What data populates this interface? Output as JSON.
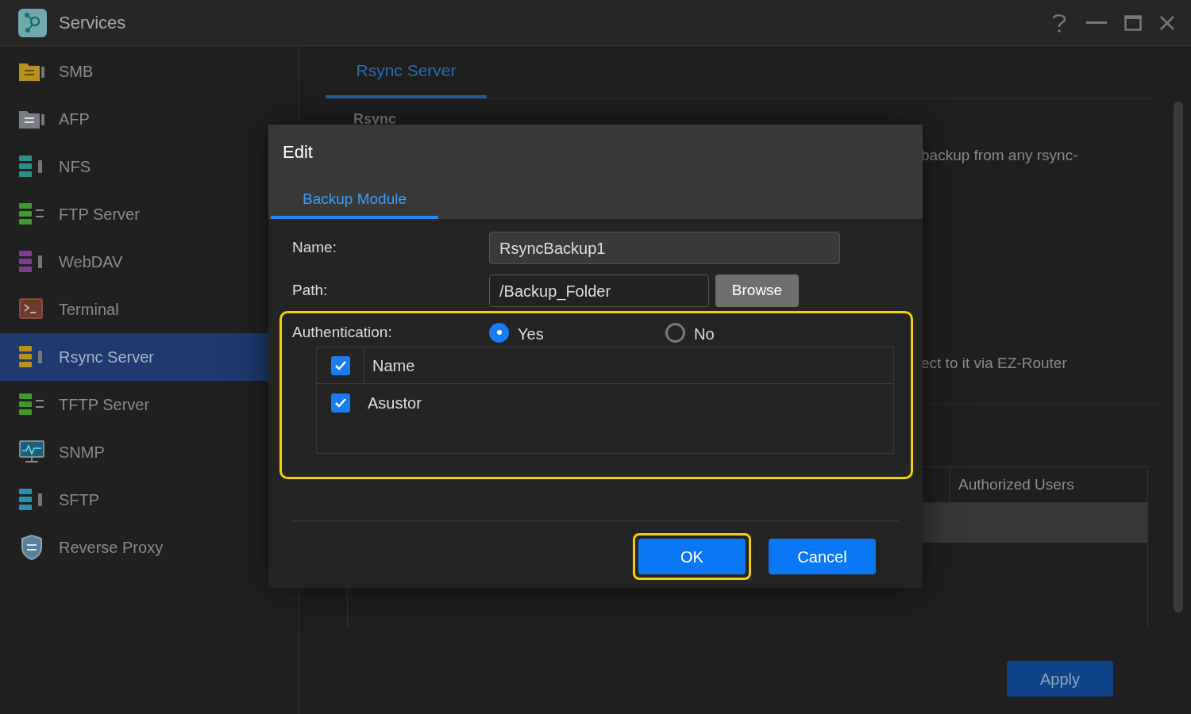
{
  "window": {
    "title": "Services"
  },
  "sidebar": {
    "items": [
      {
        "label": "SMB",
        "selected": false
      },
      {
        "label": "AFP",
        "selected": false
      },
      {
        "label": "NFS",
        "selected": false
      },
      {
        "label": "FTP Server",
        "selected": false
      },
      {
        "label": "WebDAV",
        "selected": false
      },
      {
        "label": "Terminal",
        "selected": false
      },
      {
        "label": "Rsync Server",
        "selected": true
      },
      {
        "label": "TFTP Server",
        "selected": false
      },
      {
        "label": "SNMP",
        "selected": false
      },
      {
        "label": "SFTP",
        "selected": false
      },
      {
        "label": "Reverse Proxy",
        "selected": false
      }
    ]
  },
  "content": {
    "tabs": [
      {
        "label": "Rsync Server",
        "selected": true
      }
    ],
    "section_heading": "Rsync",
    "description_lines": [
      "backup from any rsync-",
      "ect to it via EZ-Router"
    ],
    "table": {
      "columns": [
        "Authorized Users"
      ]
    },
    "apply_button": "Apply"
  },
  "dialog": {
    "title": "Edit",
    "tabs": [
      {
        "label": "Backup Module",
        "selected": true
      }
    ],
    "name": {
      "label": "Name:",
      "value": "RsyncBackup1"
    },
    "path": {
      "label": "Path:",
      "value": "/Backup_Folder",
      "button": "Browse"
    },
    "authentication": {
      "label": "Authentication:",
      "highlighted": true,
      "options": [
        {
          "label": "Yes",
          "selected": true
        },
        {
          "label": "No",
          "selected": false
        }
      ],
      "table": {
        "header": {
          "label": "Name",
          "checked": true
        },
        "rows": [
          {
            "name": "Asustor",
            "checked": true
          }
        ]
      }
    },
    "buttons": [
      {
        "label": "OK",
        "highlighted": true
      },
      {
        "label": "Cancel",
        "highlighted": false
      }
    ]
  }
}
